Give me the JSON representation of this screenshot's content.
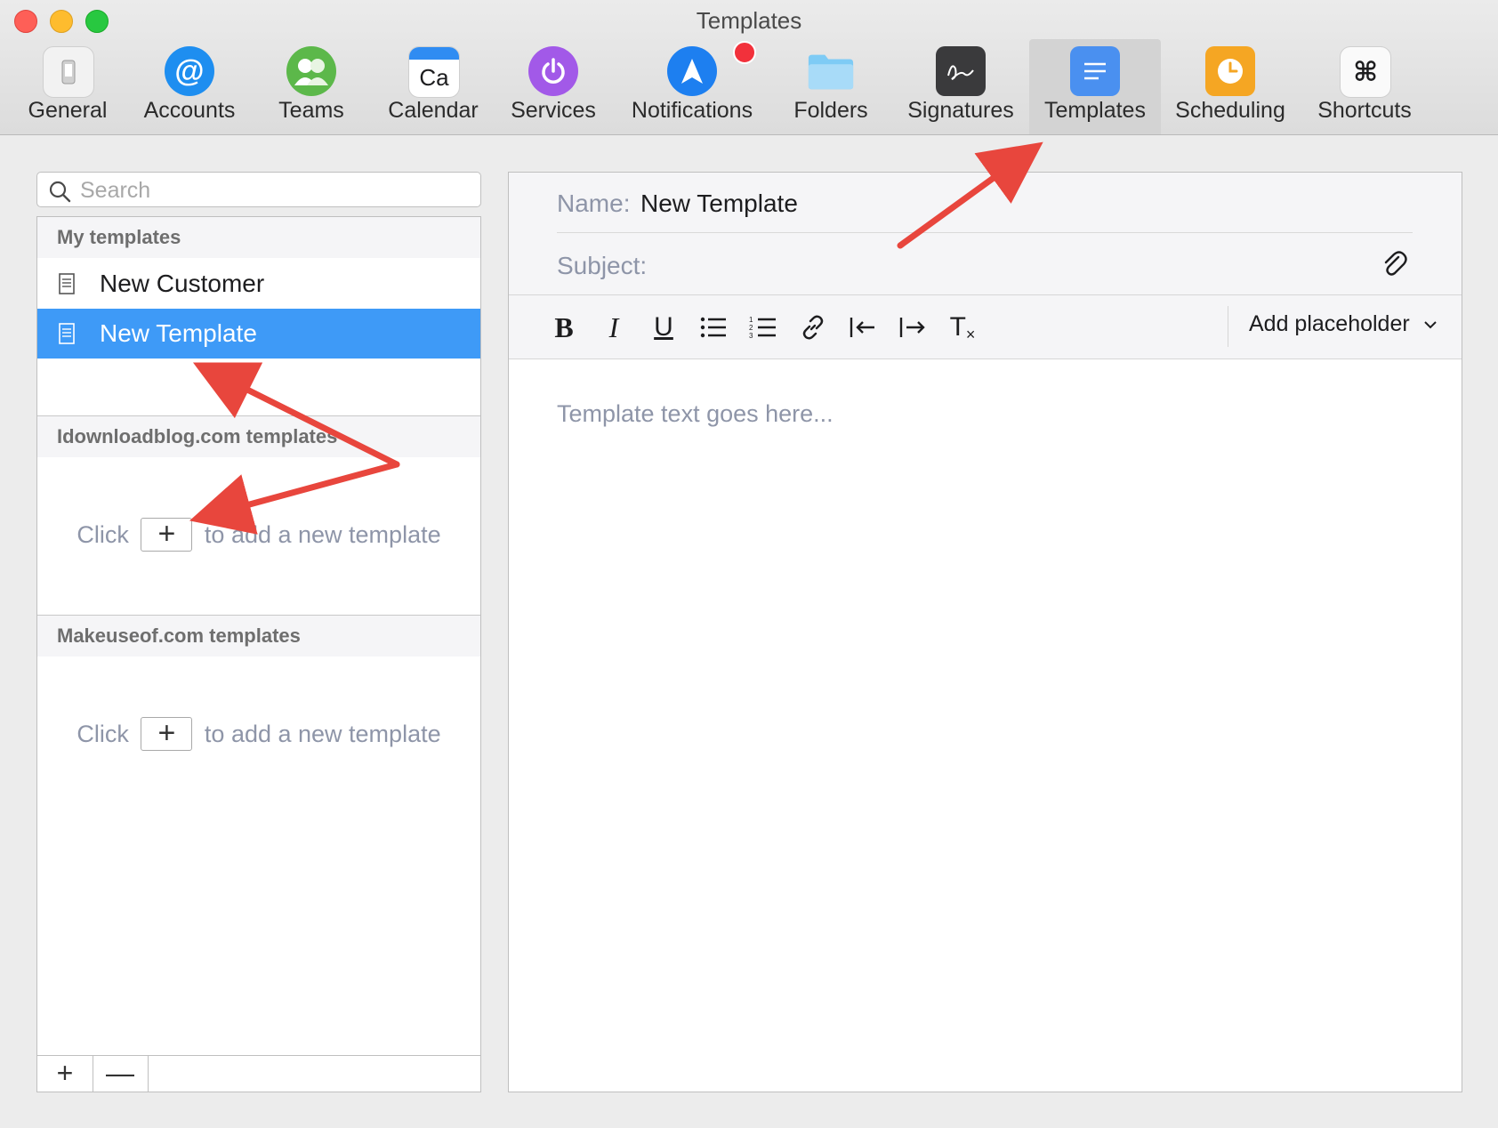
{
  "window": {
    "title": "Templates"
  },
  "toolbar": {
    "items": [
      {
        "label": "General",
        "icon": "general-icon",
        "active": false
      },
      {
        "label": "Accounts",
        "icon": "at-icon",
        "active": false
      },
      {
        "label": "Teams",
        "icon": "teams-icon",
        "active": false
      },
      {
        "label": "Calendar",
        "icon": "calendar-icon",
        "active": false,
        "icon_text": "Ca"
      },
      {
        "label": "Services",
        "icon": "power-icon",
        "active": false
      },
      {
        "label": "Notifications",
        "icon": "paper-plane-icon",
        "active": false
      },
      {
        "label": "Folders",
        "icon": "folder-icon",
        "active": false
      },
      {
        "label": "Signatures",
        "icon": "signature-icon",
        "active": false
      },
      {
        "label": "Templates",
        "icon": "templates-icon",
        "active": true
      },
      {
        "label": "Scheduling",
        "icon": "clock-icon",
        "active": false
      },
      {
        "label": "Shortcuts",
        "icon": "command-icon",
        "active": false,
        "icon_text": "⌘"
      }
    ]
  },
  "sidebar": {
    "search_placeholder": "Search",
    "groups": [
      {
        "header": "My templates",
        "items": [
          {
            "label": "New Customer",
            "selected": false
          },
          {
            "label": "New Template",
            "selected": true
          }
        ]
      },
      {
        "header": "Idownloadblog.com templates",
        "empty_hint_before": "Click",
        "empty_hint_after": "to add a new template"
      },
      {
        "header": "Makeuseof.com templates",
        "empty_hint_before": "Click",
        "empty_hint_after": "to add a new template"
      }
    ],
    "footer": {
      "add": "+",
      "remove": "—"
    }
  },
  "editor": {
    "name_label": "Name:",
    "name_value": "New Template",
    "subject_label": "Subject:",
    "subject_value": "",
    "format_buttons": {
      "bold": "B",
      "italic": "I",
      "underline": "U",
      "clear_format": "T"
    },
    "add_placeholder": "Add placeholder",
    "body_placeholder": "Template text goes here..."
  },
  "colors": {
    "selection": "#3e9af7",
    "annotation_arrow": "#e8463d"
  }
}
